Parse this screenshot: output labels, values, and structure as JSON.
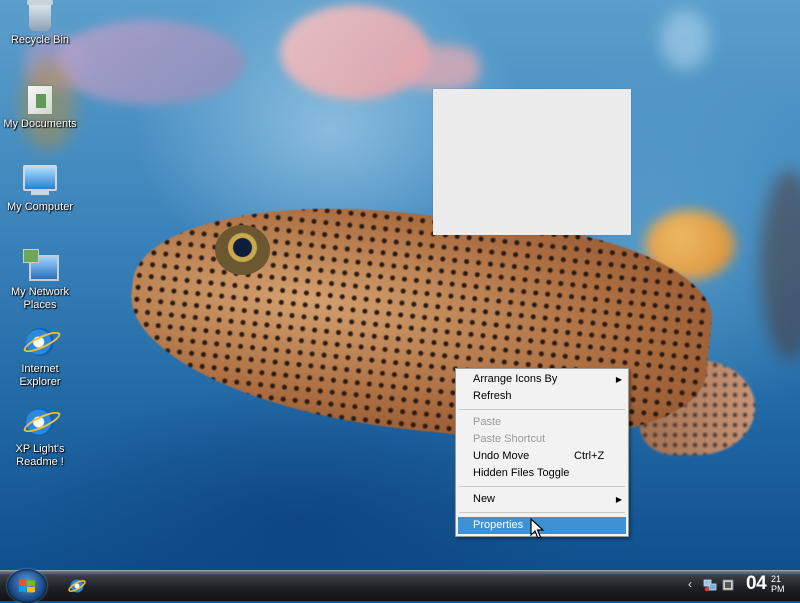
{
  "desktop": {
    "icons": [
      {
        "label": "Recycle Bin",
        "icon": "recycle-bin-icon"
      },
      {
        "label": "My Documents",
        "icon": "my-documents-icon"
      },
      {
        "label": "My Computer",
        "icon": "my-computer-icon"
      },
      {
        "label": "My Network Places",
        "icon": "network-places-icon"
      },
      {
        "label": "Internet Explorer",
        "icon": "internet-explorer-icon"
      },
      {
        "label": "XP Light's Readme !",
        "icon": "readme-shortcut-icon"
      }
    ]
  },
  "context_menu": {
    "items": [
      {
        "label": "Arrange Icons By",
        "submenu": true,
        "disabled": false
      },
      {
        "label": "Refresh",
        "disabled": false
      },
      {
        "label": "Paste",
        "disabled": true
      },
      {
        "label": "Paste Shortcut",
        "disabled": true
      },
      {
        "label": "Undo Move",
        "shortcut": "Ctrl+Z",
        "disabled": false
      },
      {
        "label": "Hidden Files Toggle",
        "disabled": false
      },
      {
        "label": "New",
        "submenu": true,
        "disabled": false
      },
      {
        "label": "Properties",
        "highlighted": true,
        "disabled": false
      }
    ]
  },
  "taskbar": {
    "clock_hour": "04",
    "clock_minute": "21",
    "clock_period": "PM",
    "tray_chevron": "‹",
    "quick_launch": [
      "internet-explorer-icon"
    ]
  },
  "colors": {
    "menu_highlight": "#3f91d6",
    "taskbar": "#1e2126"
  }
}
